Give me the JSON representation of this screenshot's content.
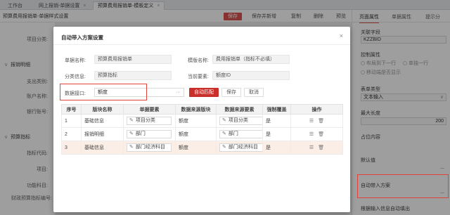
{
  "tabs": [
    {
      "label": "工作台",
      "active": false
    },
    {
      "label": "网上报销-单据设置",
      "active": false
    },
    {
      "label": "预算费用报销单-模板定义",
      "active": true
    }
  ],
  "subtitle": "预算费用报销单-单据样式设置",
  "toolbar": {
    "save": "保存",
    "save_new": "保存并新增",
    "copy": "复制",
    "delete": "删除",
    "preview": "预览"
  },
  "left_form": {
    "item_category": "项目分类:",
    "section_reimburse": "报销明细",
    "payment_type": "支出类别:",
    "account_name": "账户名称:",
    "bank_account": "银行账号:",
    "section_budget": "预算指标",
    "indicator_code": "指标代码:",
    "project": "项目:",
    "function_subject": "功能科目:",
    "fin_budget": "财政预算指标编号:"
  },
  "right_panel": {
    "tabs": [
      "页面属性",
      "单据属性",
      "提示分"
    ],
    "linked_field_label": "关联字段",
    "linked_field_value": "KZZBID",
    "control_label": "控制属性",
    "radio1": "布局到下一行",
    "radio2": "单独一行",
    "radio3": "移动端是否显示",
    "form_type_label": "表单类型",
    "form_type_value": "文本输入",
    "max_len_label": "最大长度",
    "max_len_value": "200",
    "placeholder_label": "占位内容",
    "default_label": "默认值",
    "auto_scheme_label": "自动带入方案",
    "auto_scheme_value": "...",
    "bottom_label": "根据输入信息自动填出"
  },
  "modal": {
    "title": "自动带入方案设置",
    "close": "×",
    "fields": {
      "bill_name_label": "单据名称:",
      "bill_name_value": "预算费用报销单",
      "template_label": "模版名称:",
      "template_value": "费用报销单（指标不必填）",
      "category_label": "分类信息:",
      "category_value": "预算指标",
      "current_element_label": "当前要素:",
      "current_element_value": "额度ID",
      "data_interface_label": "数据接口:",
      "data_interface_value": "额度",
      "data_interface_btn": "···"
    },
    "buttons": {
      "auto_match": "自动匹配",
      "save": "保存",
      "cancel": "取消"
    },
    "table": {
      "headers": [
        "序号",
        "版块名称",
        "单据要素",
        "数据来源版块",
        "数据来源要素",
        "强制覆盖",
        "操作"
      ],
      "rows": [
        {
          "index": "1",
          "block": "基础信息",
          "element": "项目分类",
          "source_block": "额度",
          "source_element": "项目分类",
          "force": "是"
        },
        {
          "index": "2",
          "block": "报销明细",
          "element": "部门",
          "source_block": "额度",
          "source_element": "部门",
          "force": "是"
        },
        {
          "index": "3",
          "block": "基础信息",
          "element": "部门经济科目",
          "source_block": "额度",
          "source_element": "部门经济科目",
          "force": "是"
        }
      ]
    }
  },
  "colors": {
    "accent": "#c9302c",
    "highlight_row": "#fbeee6",
    "annotation": "#e0413b"
  }
}
